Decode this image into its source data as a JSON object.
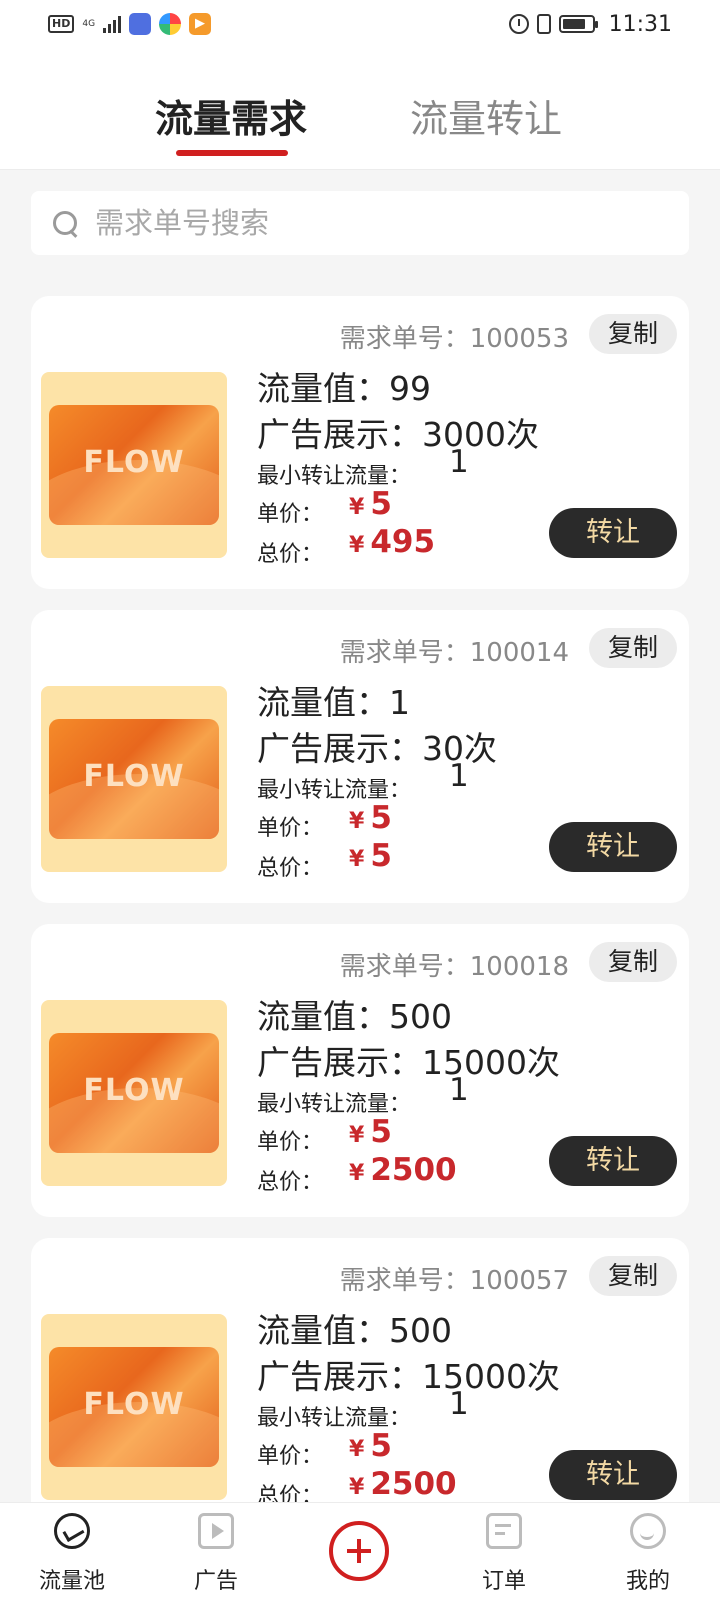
{
  "status_bar": {
    "hd": "HD",
    "network": "4G",
    "time": "11:31"
  },
  "tabs": [
    {
      "label": "流量需求",
      "active": true
    },
    {
      "label": "流量转让",
      "active": false
    }
  ],
  "search": {
    "placeholder": "需求单号搜索"
  },
  "labels": {
    "order_prefix": "需求单号：",
    "copy": "复制",
    "flow_prefix": "流量值：",
    "ad_prefix": "广告展示：",
    "min_label": "最小转让流量：",
    "unit_label": "单价：",
    "total_label": "总价：",
    "currency": "¥",
    "transfer": "转让",
    "thumb_text": "FLOW"
  },
  "cards": [
    {
      "order_no": "100053",
      "flow_value": "99",
      "ad_display": "3000次",
      "min_transfer": "1",
      "unit_price": "5",
      "total_price": "495"
    },
    {
      "order_no": "100014",
      "flow_value": "1",
      "ad_display": "30次",
      "min_transfer": "1",
      "unit_price": "5",
      "total_price": "5"
    },
    {
      "order_no": "100018",
      "flow_value": "500",
      "ad_display": "15000次",
      "min_transfer": "1",
      "unit_price": "5",
      "total_price": "2500"
    },
    {
      "order_no": "100057",
      "flow_value": "500",
      "ad_display": "15000次",
      "min_transfer": "1",
      "unit_price": "5",
      "total_price": "2500"
    }
  ],
  "bottom_nav": [
    {
      "label": "流量池",
      "icon": "pool-icon",
      "active": true
    },
    {
      "label": "广告",
      "icon": "ad-play-icon",
      "active": false
    },
    {
      "label": "",
      "icon": "plus-icon",
      "active": false
    },
    {
      "label": "订单",
      "icon": "order-icon",
      "active": false
    },
    {
      "label": "我的",
      "icon": "profile-icon",
      "active": false
    }
  ],
  "colors": {
    "accent": "#d01f1f",
    "price": "#c8282c",
    "button_dark": "#2a2a2a",
    "button_text": "#f3d9a4"
  }
}
